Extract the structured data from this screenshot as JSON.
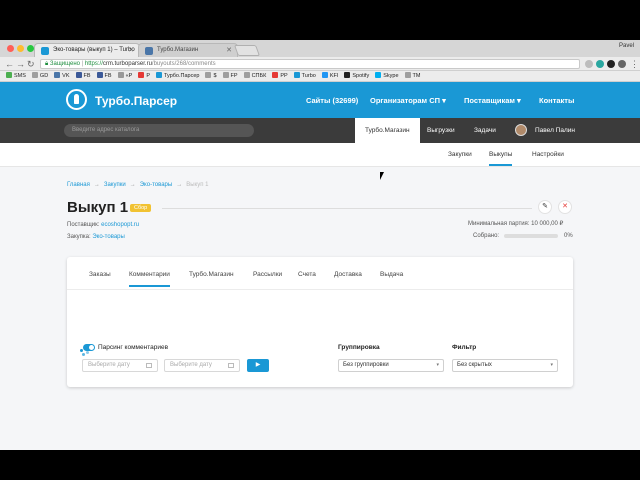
{
  "browser": {
    "tabs": [
      {
        "title": "Эко-товары (выкуп 1) – Turbo",
        "active": true
      },
      {
        "title": "Турбо.Магазин",
        "active": false
      }
    ],
    "profile_name": "Pavel",
    "secure_label": "Защищено",
    "url_scheme": "https://",
    "url_host": "crm.turboparser.ru",
    "url_path": "/buyouts/268/comments",
    "bookmarks": [
      "SMS",
      "GD",
      "VK",
      "FB",
      "FB",
      "«P",
      "P",
      "Турбо.Парсер",
      "$",
      "FP",
      "СПБК",
      "PP",
      "Turbo",
      "KFI",
      "Spotify",
      "Skype",
      "TM"
    ],
    "colors": {
      "close": "#ff5f57",
      "minimize": "#febc2e",
      "zoom": "#28c840"
    }
  },
  "header": {
    "brand": "Турбо.Парсер",
    "nav": [
      {
        "label": "Сайты (32699)",
        "dropdown": false
      },
      {
        "label": "Организаторам СП",
        "dropdown": true
      },
      {
        "label": "Поставщикам",
        "dropdown": true
      },
      {
        "label": "Контакты",
        "dropdown": false
      }
    ],
    "color": "#1a98d5"
  },
  "subheader": {
    "search_placeholder": "Введите адрес каталога",
    "items": [
      "Турбо.Магазин",
      "Выгрузки",
      "Задачи"
    ],
    "user_name": "Павел Палин"
  },
  "thirdnav": {
    "items": [
      "Закупки",
      "Выкупы",
      "Настройки"
    ],
    "active": "Выкупы"
  },
  "page": {
    "breadcrumbs": [
      "Главная",
      "Закупки",
      "Эко-товары",
      "Выкуп 1"
    ],
    "title": "Выкуп 1",
    "badge": "Сбор",
    "supplier_label": "Поставщик:",
    "supplier_value": "ecoshopopt.ru",
    "purchase_label": "Закупка:",
    "purchase_value": "Эко-товары",
    "min_batch": "Минимальная партия: 10 000,00 ₽",
    "collected_label": "Собрано:",
    "collected_value": "0%",
    "collected_fraction": 0
  },
  "card": {
    "tabs": [
      "Заказы",
      "Комментарии",
      "Турбо.Магазин",
      "Рассылки",
      "Счета",
      "Доставка",
      "Выдача"
    ],
    "active_tab": "Комментарии",
    "toggle_label": "Парсинг комментариев",
    "toggle_on": true,
    "date_from_placeholder": "Выберите дату",
    "date_to_placeholder": "Выберите дату",
    "go_label": "▶",
    "group_label": "Группировка",
    "group_value": "Без группировки",
    "filter_label": "Фильтр",
    "filter_value": "Без скрытых"
  },
  "icons": {
    "pencil": "✎",
    "close": "✕",
    "caret": "▾"
  }
}
